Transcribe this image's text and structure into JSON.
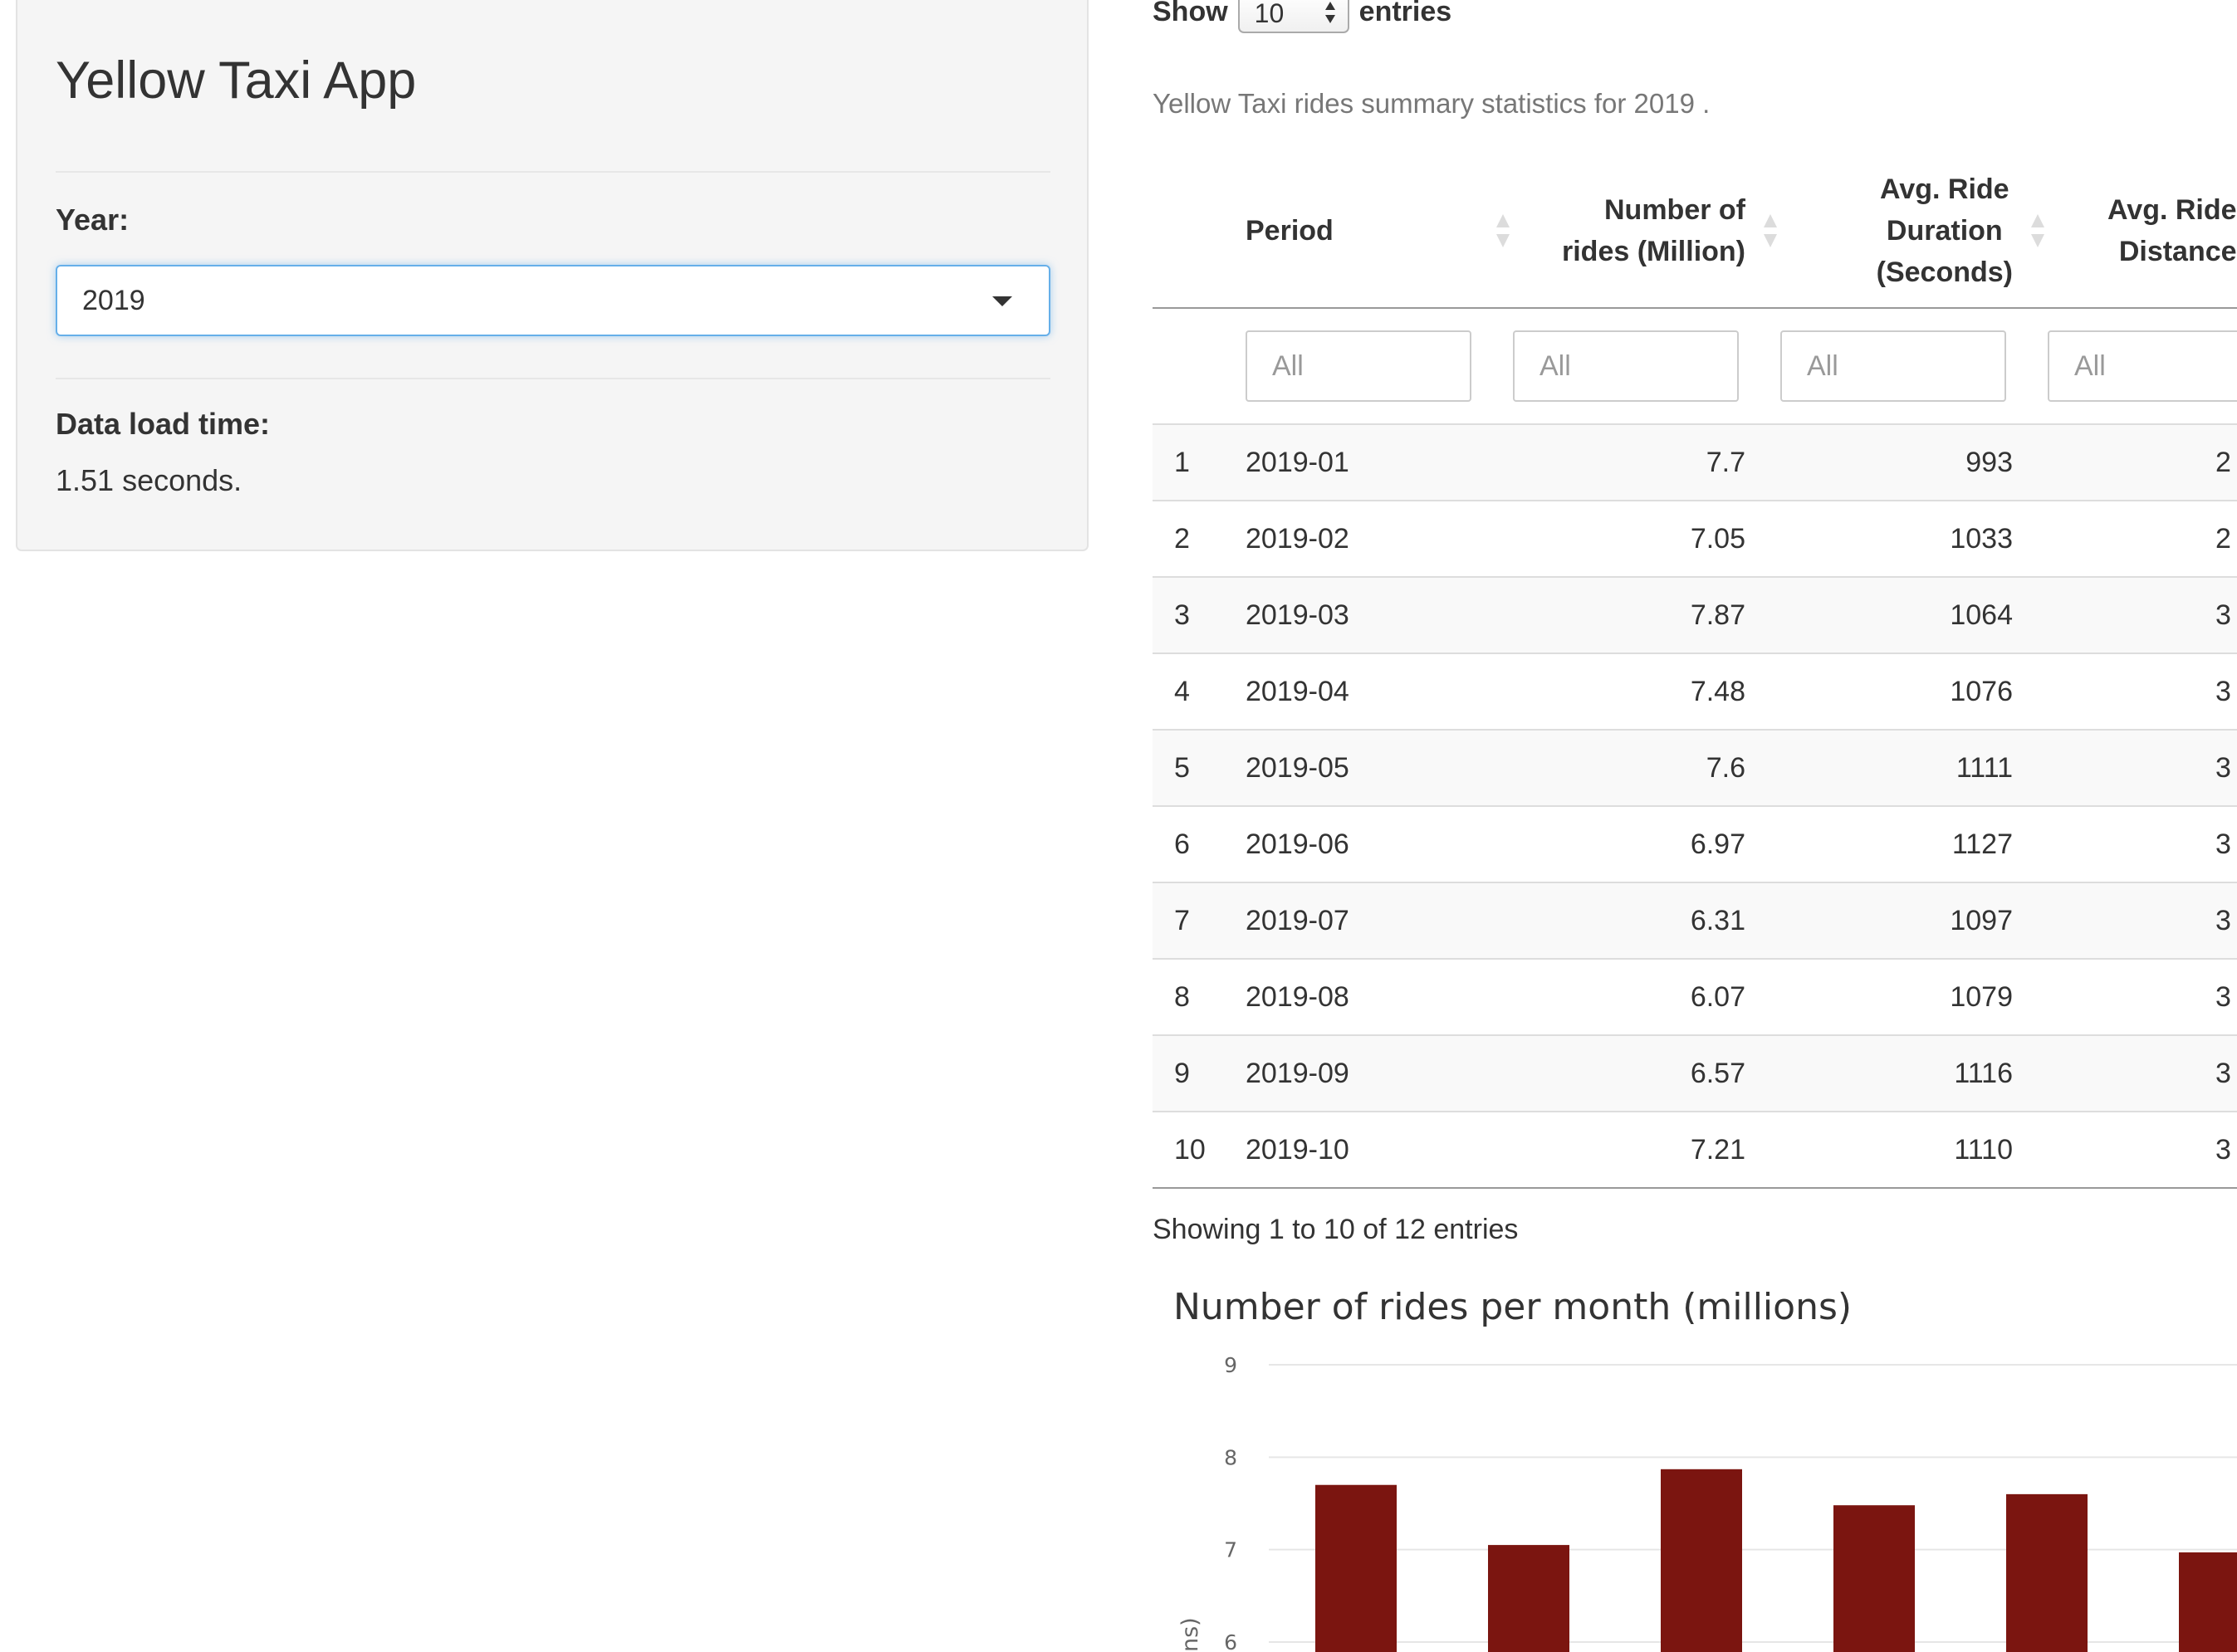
{
  "sidebar": {
    "app_title": "Yellow Taxi App",
    "year_label": "Year:",
    "year_value": "2019",
    "load_time_label": "Data load time:",
    "load_time_value": "1.51 seconds."
  },
  "table_controls": {
    "show_label": "Show",
    "page_length": "10",
    "entries_label": "entries"
  },
  "table": {
    "caption": "Yellow Taxi rides summary statistics for 2019 .",
    "columns": [
      {
        "key": "period",
        "label": "Period"
      },
      {
        "key": "rides",
        "label": "Number of rides (Million)",
        "lines": [
          "Number of",
          "rides (Million)"
        ]
      },
      {
        "key": "duration",
        "label": "Avg. Ride Duration (Seconds)",
        "lines": [
          "Avg. Ride",
          "Duration",
          "(Seconds)"
        ]
      },
      {
        "key": "distance",
        "label": "Avg. Ride Distance",
        "lines": [
          "Avg. Ride",
          "Distance"
        ]
      }
    ],
    "filter_placeholder": "All",
    "rows": [
      {
        "idx": "1",
        "period": "2019-01",
        "rides": "7.7",
        "duration": "993",
        "distance": "2"
      },
      {
        "idx": "2",
        "period": "2019-02",
        "rides": "7.05",
        "duration": "1033",
        "distance": "2"
      },
      {
        "idx": "3",
        "period": "2019-03",
        "rides": "7.87",
        "duration": "1064",
        "distance": "3"
      },
      {
        "idx": "4",
        "period": "2019-04",
        "rides": "7.48",
        "duration": "1076",
        "distance": "3"
      },
      {
        "idx": "5",
        "period": "2019-05",
        "rides": "7.6",
        "duration": "1111",
        "distance": "3"
      },
      {
        "idx": "6",
        "period": "2019-06",
        "rides": "6.97",
        "duration": "1127",
        "distance": "3"
      },
      {
        "idx": "7",
        "period": "2019-07",
        "rides": "6.31",
        "duration": "1097",
        "distance": "3"
      },
      {
        "idx": "8",
        "period": "2019-08",
        "rides": "6.07",
        "duration": "1079",
        "distance": "3"
      },
      {
        "idx": "9",
        "period": "2019-09",
        "rides": "6.57",
        "duration": "1116",
        "distance": "3"
      },
      {
        "idx": "10",
        "period": "2019-10",
        "rides": "7.21",
        "duration": "1110",
        "distance": "3"
      }
    ],
    "info": "Showing 1 to 10 of 12 entries"
  },
  "chart_data": {
    "type": "bar",
    "title": "Number of rides per month (millions)",
    "ylabel_partial": "ns)",
    "yticks": [
      6,
      7,
      8,
      9
    ],
    "ylim_visible": [
      6,
      9
    ],
    "values": [
      7.7,
      7.05,
      7.87,
      7.48,
      7.6,
      6.97
    ],
    "grid": true,
    "bar_color": "#7b1510"
  },
  "colors": {
    "sidebar_bg": "#f5f5f5",
    "focus_border": "#66afe9",
    "bar": "#7b1510",
    "stripe": "#f9f9f9"
  }
}
